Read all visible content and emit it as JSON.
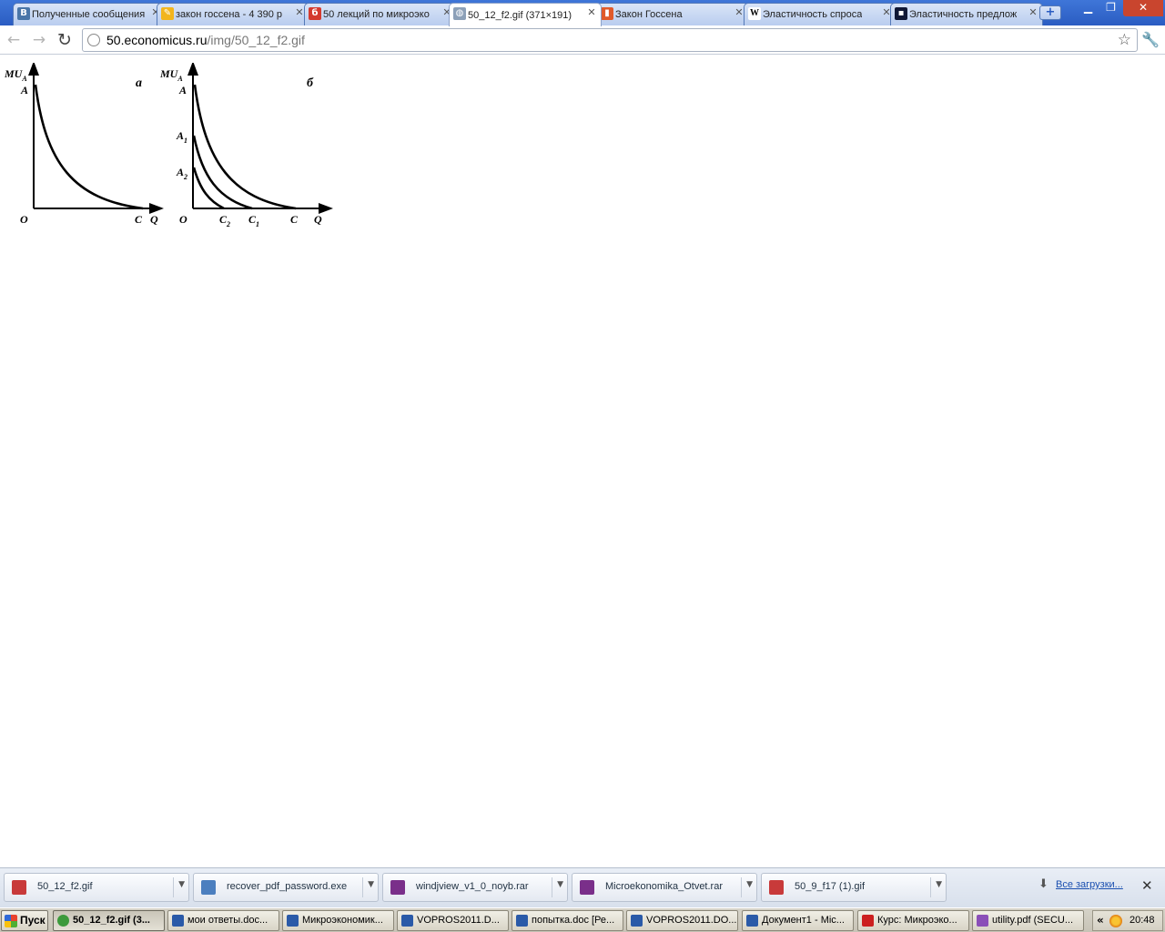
{
  "browser": {
    "tabs": [
      {
        "title": "Полученные сообщения",
        "icon": "vk-icon",
        "color": "#4a76a8",
        "glyph": "В"
      },
      {
        "title": "закон госсена - 4 390 р",
        "icon": "yandex-search-icon",
        "color": "#f2b51d",
        "glyph": "✎"
      },
      {
        "title": "50 лекций по микроэко",
        "icon": "bookmark-red-icon",
        "color": "#d43a2f",
        "glyph": "б"
      },
      {
        "title": "50_12_f2.gif (371×191)",
        "icon": "globe-icon",
        "color": "#8ca0b8",
        "glyph": "◍"
      },
      {
        "title": "Закон Госсена",
        "icon": "bar-chart-icon",
        "color": "#e05a2b",
        "glyph": "▮"
      },
      {
        "title": "Эластичность спроса",
        "icon": "wikipedia-icon",
        "color": "#ffffff",
        "glyph": "W"
      },
      {
        "title": "Эластичность предлож",
        "icon": "dark-site-icon",
        "color": "#101836",
        "glyph": "▪"
      }
    ],
    "active_tab": 3,
    "new_tab_symbol": "+",
    "window_controls": {
      "minimize": "▁",
      "maximize": "❐",
      "close": "✕"
    },
    "toolbar": {
      "back": "←",
      "forward": "→",
      "reload": "↻",
      "url_host": "50.economicus.ru",
      "url_path": "/img/50_12_f2.gif",
      "star": "☆",
      "wrench": "🔧"
    }
  },
  "figure": {
    "panel_a": {
      "label": "а",
      "y_axis": "MU",
      "y_axis_sub": "A",
      "intercept": "A",
      "origin": "O",
      "x_intercept": "C",
      "x_axis": "Q"
    },
    "panel_b": {
      "label": "б",
      "y_axis": "MU",
      "y_axis_sub": "A",
      "intercepts": [
        {
          "main": "A",
          "sub": ""
        },
        {
          "main": "A",
          "sub": "1"
        },
        {
          "main": "A",
          "sub": "2"
        }
      ],
      "origin": "O",
      "x_intercepts": [
        {
          "main": "C",
          "sub": "2"
        },
        {
          "main": "C",
          "sub": "1"
        },
        {
          "main": "C",
          "sub": ""
        }
      ],
      "x_axis": "Q"
    }
  },
  "downloads": {
    "items": [
      {
        "name": "50_12_f2.gif",
        "icon": "image-file-icon",
        "color": "#c83a3a"
      },
      {
        "name": "recover_pdf_password.exe",
        "icon": "installer-icon",
        "color": "#4c7fbf"
      },
      {
        "name": "windjview_v1_0_noyb.rar",
        "icon": "winrar-icon",
        "color": "#7a2f8a"
      },
      {
        "name": "Microekonomika_Otvet.rar",
        "icon": "winrar-icon",
        "color": "#7a2f8a"
      },
      {
        "name": "50_9_f17 (1).gif",
        "icon": "image-file-icon",
        "color": "#c83a3a"
      }
    ],
    "all_downloads": "Все загрузки...",
    "close": "✕"
  },
  "taskbar": {
    "start": "Пуск",
    "items": [
      {
        "title": "50_12_f2.gif (3...",
        "icon": "chrome-icon",
        "color": "#3b9a3b",
        "active": true
      },
      {
        "title": "мои ответы.doc...",
        "icon": "word-icon",
        "color": "#2a5aa8"
      },
      {
        "title": "Микроэкономик...",
        "icon": "word-icon",
        "color": "#2a5aa8"
      },
      {
        "title": "VOPROS2011.D...",
        "icon": "word-icon",
        "color": "#2a5aa8"
      },
      {
        "title": "попытка.doc [Ре...",
        "icon": "word-icon",
        "color": "#2a5aa8"
      },
      {
        "title": "VOPROS2011.DO...",
        "icon": "word-icon",
        "color": "#2a5aa8"
      },
      {
        "title": "Документ1 - Mic...",
        "icon": "word-icon",
        "color": "#2a5aa8"
      },
      {
        "title": "Курс: Микроэко...",
        "icon": "opera-icon",
        "color": "#cc1f1f"
      },
      {
        "title": "utility.pdf (SECU...",
        "icon": "pdf-viewer-icon",
        "color": "#8a4fb8"
      }
    ],
    "tray_arrow": "«",
    "clock": "20:48"
  }
}
